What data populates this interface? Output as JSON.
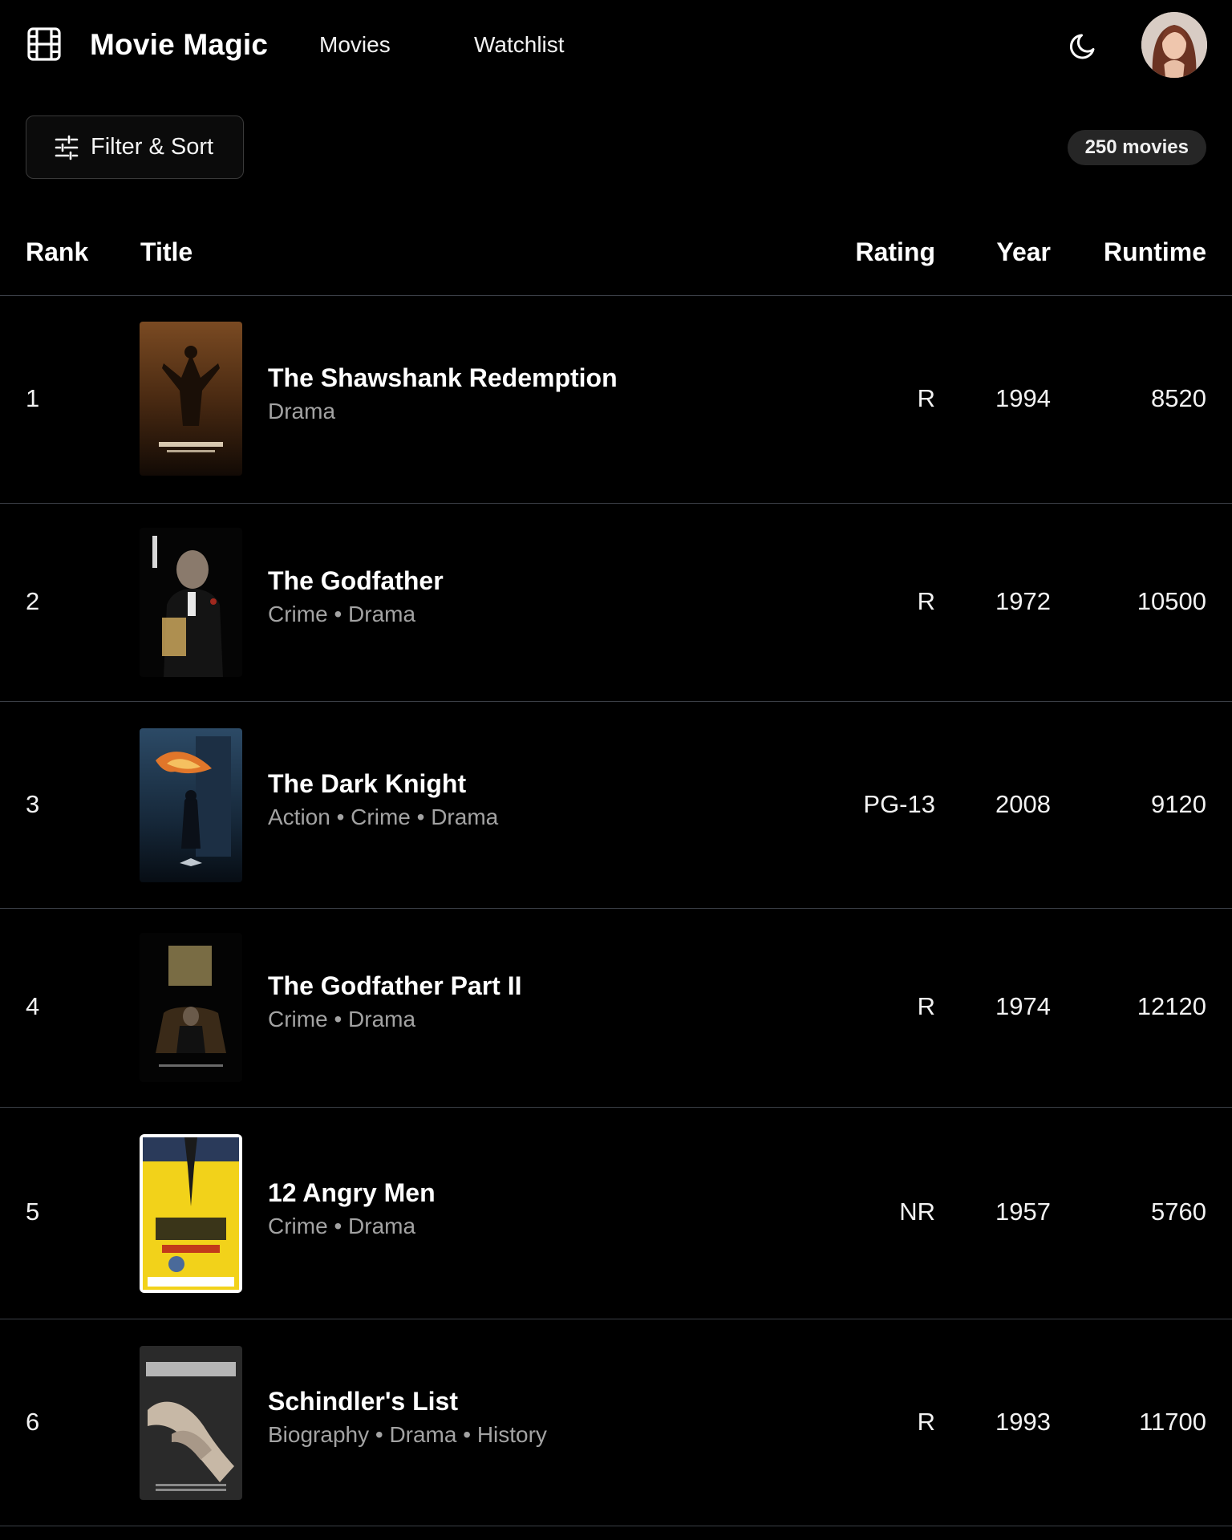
{
  "app": {
    "brand": "Movie Magic",
    "nav": {
      "movies": "Movies",
      "watchlist": "Watchlist"
    },
    "theme_icon": "moon-icon",
    "logo_icon": "film-icon"
  },
  "toolbar": {
    "filter_label": "Filter & Sort",
    "count_badge": "250 movies"
  },
  "table": {
    "columns": {
      "rank": "Rank",
      "title": "Title",
      "rating": "Rating",
      "year": "Year",
      "runtime": "Runtime"
    },
    "rows": [
      {
        "rank": "1",
        "title": "The Shawshank Redemption",
        "genres": "Drama",
        "rating": "R",
        "year": "1994",
        "runtime": "8520"
      },
      {
        "rank": "2",
        "title": "The Godfather",
        "genres": "Crime • Drama",
        "rating": "R",
        "year": "1972",
        "runtime": "10500"
      },
      {
        "rank": "3",
        "title": "The Dark Knight",
        "genres": "Action • Crime • Drama",
        "rating": "PG-13",
        "year": "2008",
        "runtime": "9120"
      },
      {
        "rank": "4",
        "title": "The Godfather Part II",
        "genres": "Crime • Drama",
        "rating": "R",
        "year": "1974",
        "runtime": "12120"
      },
      {
        "rank": "5",
        "title": "12 Angry Men",
        "genres": "Crime • Drama",
        "rating": "NR",
        "year": "1957",
        "runtime": "5760"
      },
      {
        "rank": "6",
        "title": "Schindler's List",
        "genres": "Biography • Drama • History",
        "rating": "R",
        "year": "1993",
        "runtime": "11700"
      }
    ]
  },
  "colors": {
    "background": "#000000",
    "divider": "#3b3f47",
    "muted_text": "#a3a3a3",
    "badge_bg": "#262626"
  }
}
